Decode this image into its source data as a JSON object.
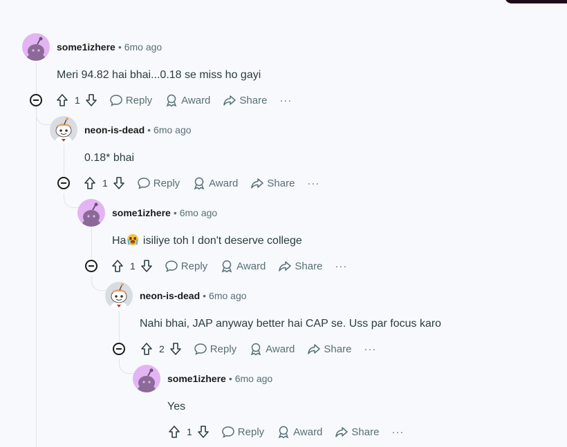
{
  "comments": [
    {
      "author": "some1izhere",
      "time": "6mo ago",
      "text": "Meri 94.82 hai bhai...0.18 se miss ho gayi",
      "votes": "1",
      "avatar": "snoo-purple"
    },
    {
      "author": "neon-is-dead",
      "time": "6mo ago",
      "text": "0.18* bhai",
      "votes": "1",
      "avatar": "snoo-face"
    },
    {
      "author": "some1izhere",
      "time": "6mo ago",
      "text_before": "Ha",
      "emoji": "crying-face-emoji",
      "text_after": " isiliye toh I don't deserve college",
      "votes": "1",
      "avatar": "snoo-purple"
    },
    {
      "author": "neon-is-dead",
      "time": "6mo ago",
      "text": "Nahi bhai, JAP anyway better hai CAP se. Uss par focus karo",
      "votes": "2",
      "avatar": "snoo-face"
    },
    {
      "author": "some1izhere",
      "time": "6mo ago",
      "text": "Yes",
      "votes": "1",
      "avatar": "snoo-purple"
    }
  ],
  "actions": {
    "reply": "Reply",
    "award": "Award",
    "share": "Share",
    "more": "···"
  },
  "separator": "•",
  "colors": {
    "background": "#f8f9fc",
    "meta_text": "#576f76",
    "purple_avatar": "#e3b4f3",
    "thread_line": "#dfe3ea"
  }
}
